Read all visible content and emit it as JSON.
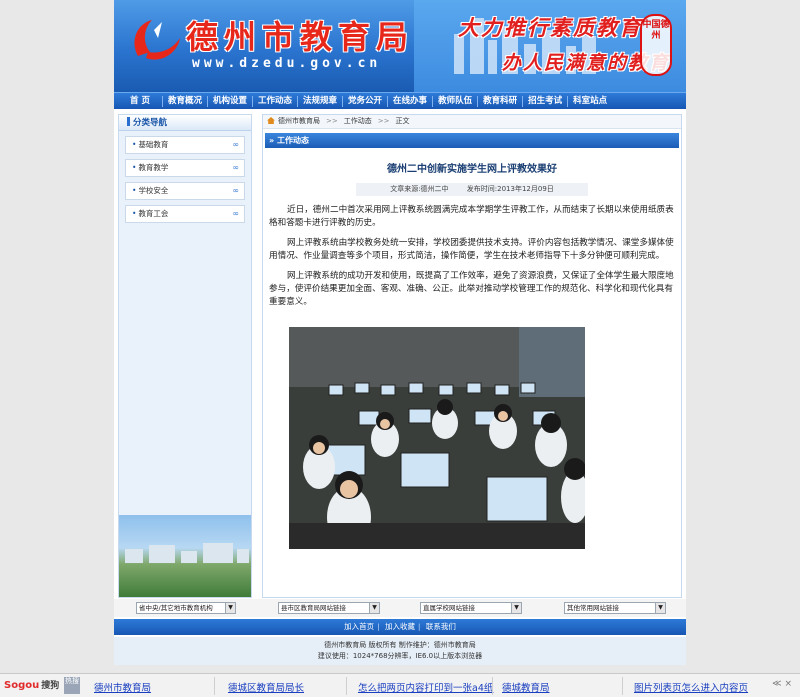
{
  "header": {
    "site_title": "德州市教育局",
    "site_url": "www.dzedu.gov.cn",
    "slogan_line1": "大力推行素质教育",
    "slogan_line2": "办人民满意的教育",
    "seal_text": "中国德州"
  },
  "nav": {
    "items": [
      "首  页",
      "教育概况",
      "机构设置",
      "工作动态",
      "法规规章",
      "党务公开",
      "在线办事",
      "教师队伍",
      "教育科研",
      "招生考试",
      "科室站点"
    ]
  },
  "sidebar": {
    "title": "分类导航",
    "items": [
      "基础教育",
      "教育教学",
      "学校安全",
      "教育工会"
    ],
    "more_glyph": "∞"
  },
  "breadcrumb": {
    "items": [
      "德州市教育局",
      "工作动态",
      "正文"
    ],
    "separator": ">>"
  },
  "section": {
    "title": "» 工作动态"
  },
  "article": {
    "title": "德州二中创新实施学生网上评教效果好",
    "source_label": "文章来源:德州二中",
    "date_label": "发布时间:2013年12月09日",
    "paragraphs": [
      "近日，德州二中首次采用网上评教系统圆满完成本学期学生评教工作，从而结束了长期以来使用纸质表格和答题卡进行评教的历史。",
      "网上评教系统由学校教务处统一安排，学校团委提供技术支持。评价内容包括教学情况、课堂多媒体使用情况、作业量调查等多个项目，形式简洁，操作简便，学生在技术老师指导下十多分钟便可顺利完成。",
      "网上评教系统的成功开发和使用，既提高了工作效率，避免了资源浪费，又保证了全体学生最大限度地参与，使评价结果更加全面、客观、准确、公正。此举对推动学校管理工作的规范化、科学化和现代化具有重要意义。"
    ]
  },
  "link_selects": [
    {
      "value": "省中央/其它地市教育机构"
    },
    {
      "value": "县市区教育局网站链接"
    },
    {
      "value": "直属学校网站链接"
    },
    {
      "value": "其他常用网站链接"
    }
  ],
  "footer": {
    "links": [
      "加入首页",
      "加入收藏",
      "联系我们"
    ],
    "copyright_line1": "德州市教育局  版权所有  制作维护：德州市教育局",
    "copyright_line2": "建议使用：1024*768分辨率，IE6.0以上版本浏览器"
  },
  "sogou_bar": {
    "logo_main": "Sogou",
    "logo_sub": "搜狗",
    "badge": "热搜",
    "links": [
      "德州市教育局",
      "德城区教育局局长",
      "怎么把两页内容打印到一张a4纸",
      "德城教育局",
      "图片列表页怎么进入内容页"
    ],
    "tools": "≪  ×"
  },
  "colors": {
    "nav_blue": "#1757b3",
    "title_red": "#e8271b",
    "heading_navy": "#1b3f73",
    "link_blue": "#1a3fc0"
  }
}
